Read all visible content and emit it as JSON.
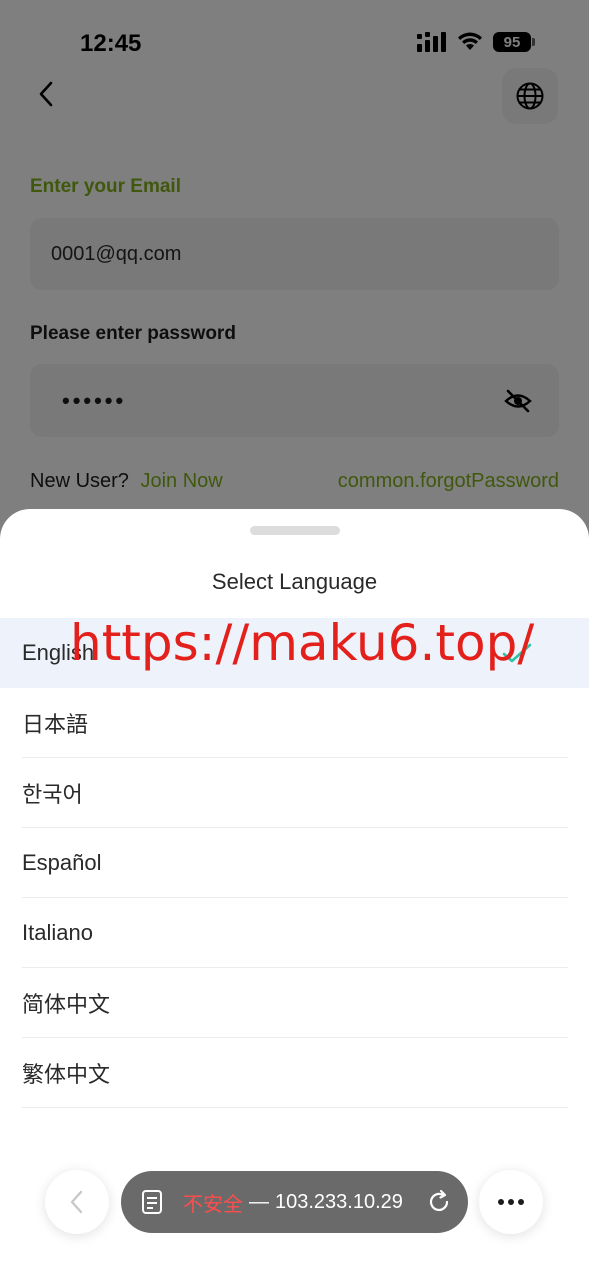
{
  "status_bar": {
    "time": "12:45",
    "battery": "95"
  },
  "login": {
    "email_label": "Enter your Email",
    "email_value": "0001@qq.com",
    "password_label": "Please enter password",
    "password_value": "••••••",
    "new_user": "New User?",
    "join_now": "Join Now",
    "forgot_password": "common.forgotPassword"
  },
  "language_sheet": {
    "title": "Select Language",
    "items": [
      {
        "label": "English",
        "selected": true
      },
      {
        "label": "日本語"
      },
      {
        "label": "한국어"
      },
      {
        "label": "Español"
      },
      {
        "label": "Italiano"
      },
      {
        "label": "简体中文"
      },
      {
        "label": "繁体中文"
      }
    ]
  },
  "watermark": "https://maku6.top/",
  "browser": {
    "security": "不安全",
    "separator": "—",
    "address": "103.233.10.29"
  },
  "colors": {
    "accent_green": "#7fb01a",
    "selected_row": "#eef3fb",
    "check": "#2ec4a6"
  }
}
